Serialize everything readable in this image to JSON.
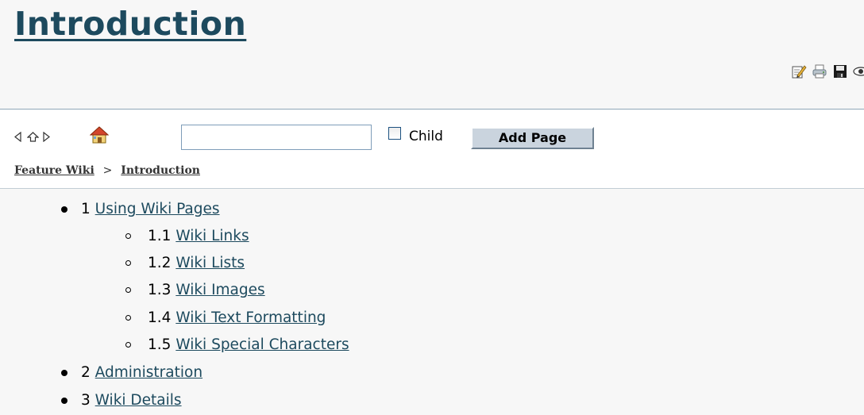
{
  "page": {
    "title": "Introduction"
  },
  "toolbar": {
    "actions": [
      {
        "icon": "edit-icon"
      },
      {
        "icon": "print-icon"
      },
      {
        "icon": "save-icon"
      },
      {
        "icon": "view-icon"
      }
    ]
  },
  "nav": {
    "icons": [
      "arrow-left-icon",
      "arrow-up-icon",
      "arrow-right-icon",
      "home-icon"
    ],
    "new_page_value": "",
    "child_label": "Child",
    "child_checked": false,
    "add_page_label": "Add Page"
  },
  "breadcrumb": {
    "items": [
      "Feature Wiki",
      "Introduction"
    ],
    "separator": ">"
  },
  "toc": [
    {
      "number": "1",
      "label": "Using Wiki Pages",
      "children": [
        {
          "number": "1.1",
          "label": "Wiki Links"
        },
        {
          "number": "1.2",
          "label": "Wiki Lists"
        },
        {
          "number": "1.3",
          "label": "Wiki Images"
        },
        {
          "number": "1.4",
          "label": "Wiki Text Formatting"
        },
        {
          "number": "1.5",
          "label": "Wiki Special Characters"
        }
      ]
    },
    {
      "number": "2",
      "label": "Administration",
      "children": []
    },
    {
      "number": "3",
      "label": "Wiki Details",
      "children": []
    }
  ],
  "colors": {
    "title": "#1d4a5e",
    "link": "#1d4a5e",
    "button_bg": "#cad4de",
    "page_bg": "#f7f7f7"
  }
}
